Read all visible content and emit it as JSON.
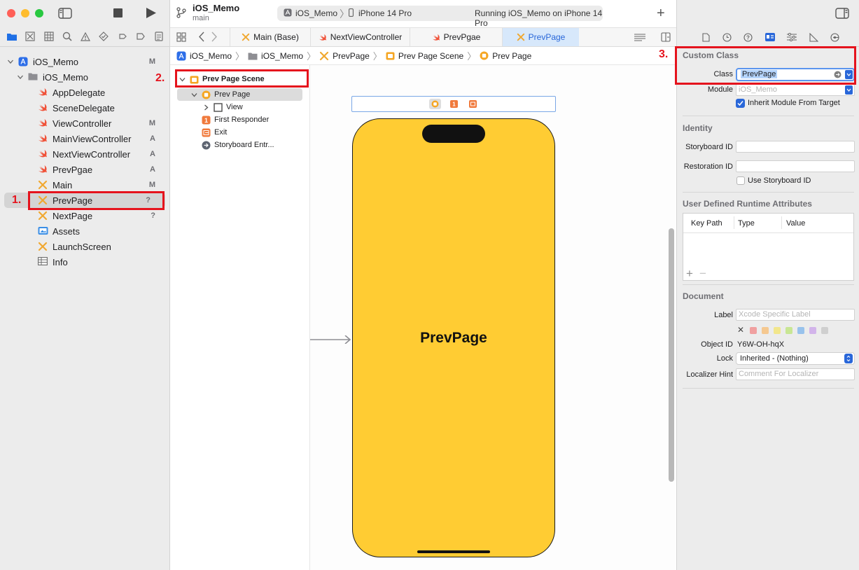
{
  "navigator": {
    "tree": [
      {
        "label": "iOS_Memo",
        "status": "M",
        "icon": "project-icon",
        "level": 0,
        "open": true
      },
      {
        "label": "iOS_Memo",
        "status": "",
        "icon": "folder-icon",
        "level": 1,
        "open": true
      },
      {
        "label": "AppDelegate",
        "status": "",
        "icon": "swift-file-icon",
        "level": 2
      },
      {
        "label": "SceneDelegate",
        "status": "",
        "icon": "swift-file-icon",
        "level": 2
      },
      {
        "label": "ViewController",
        "status": "M",
        "icon": "swift-file-icon",
        "level": 2
      },
      {
        "label": "MainViewController",
        "status": "A",
        "icon": "swift-file-icon",
        "level": 2
      },
      {
        "label": "NextViewController",
        "status": "A",
        "icon": "swift-file-icon",
        "level": 2
      },
      {
        "label": "PrevPgae",
        "status": "A",
        "icon": "swift-file-icon",
        "level": 2
      },
      {
        "label": "Main",
        "status": "M",
        "icon": "storyboard-icon",
        "level": 2
      },
      {
        "label": "PrevPage",
        "status": "?",
        "icon": "storyboard-icon",
        "level": 2,
        "selected": true
      },
      {
        "label": "NextPage",
        "status": "?",
        "icon": "storyboard-icon",
        "level": 2
      },
      {
        "label": "Assets",
        "status": "",
        "icon": "assets-icon",
        "level": 2
      },
      {
        "label": "LaunchScreen",
        "status": "",
        "icon": "storyboard-icon",
        "level": 2
      },
      {
        "label": "Info",
        "status": "",
        "icon": "plist-icon",
        "level": 2
      }
    ]
  },
  "toolbar": {
    "project": "iOS_Memo",
    "branch": "main",
    "scheme_target": "iOS_Memo",
    "device": "iPhone 14 Pro",
    "status": "Running iOS_Memo on iPhone 14 Pro"
  },
  "tabs": [
    {
      "label": "Main (Base)",
      "icon": "storyboard-icon"
    },
    {
      "label": "NextViewController",
      "icon": "swift-file-icon"
    },
    {
      "label": "PrevPgae",
      "icon": "swift-file-icon"
    },
    {
      "label": "PrevPage",
      "icon": "storyboard-icon",
      "active": true
    }
  ],
  "jumpbar": [
    {
      "label": "iOS_Memo",
      "icon": "project-icon"
    },
    {
      "label": "iOS_Memo",
      "icon": "folder-icon"
    },
    {
      "label": "PrevPage",
      "icon": "storyboard-icon"
    },
    {
      "label": "Prev Page Scene",
      "icon": "scene-icon"
    },
    {
      "label": "Prev Page",
      "icon": "view-controller-icon"
    }
  ],
  "outline": {
    "scene": "Prev Page Scene",
    "controller": "Prev Page",
    "items": [
      "View",
      "First Responder",
      "Exit",
      "Storyboard Entr..."
    ]
  },
  "canvas": {
    "screen_label": "PrevPage",
    "screen_color": "#ffcc33"
  },
  "inspector": {
    "custom_class": {
      "heading": "Custom Class",
      "class_label": "Class",
      "class_value": "PrevPage",
      "module_label": "Module",
      "module_placeholder": "iOS_Memo",
      "inherit_label": "Inherit Module From Target"
    },
    "identity": {
      "heading": "Identity",
      "storyboard_id_label": "Storyboard ID",
      "restoration_id_label": "Restoration ID",
      "use_storyboard_id_label": "Use Storyboard ID"
    },
    "runtime_attributes": {
      "heading": "User Defined Runtime Attributes",
      "columns": [
        "Key Path",
        "Type",
        "Value"
      ]
    },
    "document": {
      "heading": "Document",
      "label_label": "Label",
      "label_placeholder": "Xcode Specific Label",
      "object_id_label": "Object ID",
      "object_id_value": "Y6W-OH-hqX",
      "lock_label": "Lock",
      "lock_value": "Inherited - (Nothing)",
      "localizer_label": "Localizer Hint",
      "localizer_placeholder": "Comment For Localizer",
      "swatches": [
        "#f0a0a0",
        "#f5c890",
        "#f2e68c",
        "#c8e694",
        "#98c2ec",
        "#d2b4ea",
        "#cfcfcf"
      ]
    }
  },
  "annotations": {
    "one": "1.",
    "two": "2.",
    "three": "3."
  },
  "colors": {
    "accent": "#2967d9",
    "highlight": "#e5131d",
    "swift": "#f05138",
    "storyboard": "#f0a830"
  }
}
